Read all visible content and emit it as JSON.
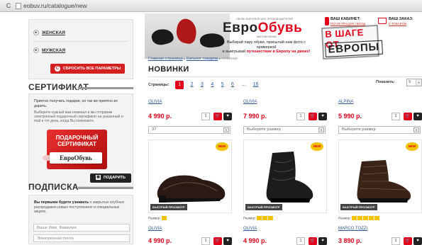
{
  "browser": {
    "url": "eobuv.ru/catalogue/new",
    "back_glyph": "C"
  },
  "sidebar": {
    "categories": [
      {
        "label": "ЖЕНСКАЯ",
        "chevron": "▸"
      },
      {
        "label": "МУЖСКАЯ",
        "chevron": "▸"
      }
    ],
    "reset_label": "СБРОСИТЬ ВСЕ ПАРАМЕТРЫ",
    "reset_icon": "С"
  },
  "certificate": {
    "title": "СЕРТИФИКАТ",
    "lead": "Приятно получать подарки, но так же приятно их дарить.",
    "text": "Выберите нужный вам номинал и мы отправим электронный подарочный сертификат на указанный e-mail в тот день, когда Вы пожелаете.",
    "card_title_1": "ПОДАРОЧНЫЙ",
    "card_title_2": "СЕРТИФИКАТ",
    "card_brand": "ЕвроОбувь",
    "button_label": "ПОДАРИТЬ",
    "button_icon": "▦"
  },
  "subscription": {
    "title": "ПОДПИСКА",
    "text_bold": "Вы первыми будете узнавать",
    "text_rest": " о закрытых клубных распродажах,новых поступлениях и специальных акциях.",
    "name_placeholder": "Ваше Имя, Фамилия",
    "email_placeholder": "Электронная почта"
  },
  "header": {
    "brand_top": "ОБУВЬ  ЕВРОПЕЙСКИХ  ПРОИЗВОДИТЕЛЕЙ",
    "brand_prefix": "Евро",
    "brand_suffix": "Обувь",
    "brand_bottom": "МАГАЗИН ОБУВИ",
    "promo_line1": "Выбирай пару обуви, присылай нам фото с примеркой",
    "promo_line2_a": "и выигрывай ",
    "promo_line2_b": "путешествие в Европу на двоих!",
    "europe_line1": "В ШАГЕ ОТ",
    "europe_line2": "ЕВРОПЫ",
    "cabinet_title": "ВАШ КАБИНЕТ:",
    "cabinet_link": "РЕГИСТРАЦИЯ / ВХОД",
    "order_title": "ВАШ ЗАКАЗ:",
    "order_link": "0 ТОВАРОВ"
  },
  "breadcrumb": {
    "home": "Главная страница",
    "catalog": "Каталог товаров",
    "current": "Новинки",
    "sep": "▸"
  },
  "page_title": "НОВИНКИ",
  "pagination": {
    "label": "Страницы:",
    "pages": [
      "1",
      "2",
      "3",
      "4",
      "5",
      "6",
      "...",
      "16"
    ]
  },
  "showing": {
    "label": "Показать:",
    "value": "9"
  },
  "products": [
    {
      "brand": "OLIVIA",
      "price": "4 990 р.",
      "qty": "1",
      "size": "37",
      "new": "NEW",
      "quick": "БЫСТРЫЙ ПРОСМОТР",
      "sizes_label": "Размер:",
      "size_count": 1
    },
    {
      "brand": "OLIVIA",
      "price": "7 990 р.",
      "qty": "1",
      "size": "Выберите размер",
      "new": "NEW",
      "quick": "БЫСТРЫЙ ПРОСМОТР",
      "sizes_label": "Размер:",
      "size_count": 3
    },
    {
      "brand": "ALPINA",
      "price": "5 990 р.",
      "qty": "1",
      "size": "Выберите размер",
      "new": "NEW",
      "quick": "БЫСТРЫЙ ПРОСМОТР",
      "sizes_label": "Размер:",
      "size_count": 5
    },
    {
      "brand": "OLIVIA",
      "price": "4 990 р.",
      "qty": "1"
    },
    {
      "brand": "OLIVIA",
      "price": "4 990 р.",
      "qty": "1"
    },
    {
      "brand": "MARCO TOZZI",
      "price": "3 890 р.",
      "qty": "1"
    }
  ],
  "icons": {
    "cart": "🛒",
    "fav": "♥",
    "dropdown": "▾"
  },
  "colors": {
    "accent": "#e2001a",
    "link": "#2c5a9c",
    "badge": "#f2c200"
  }
}
